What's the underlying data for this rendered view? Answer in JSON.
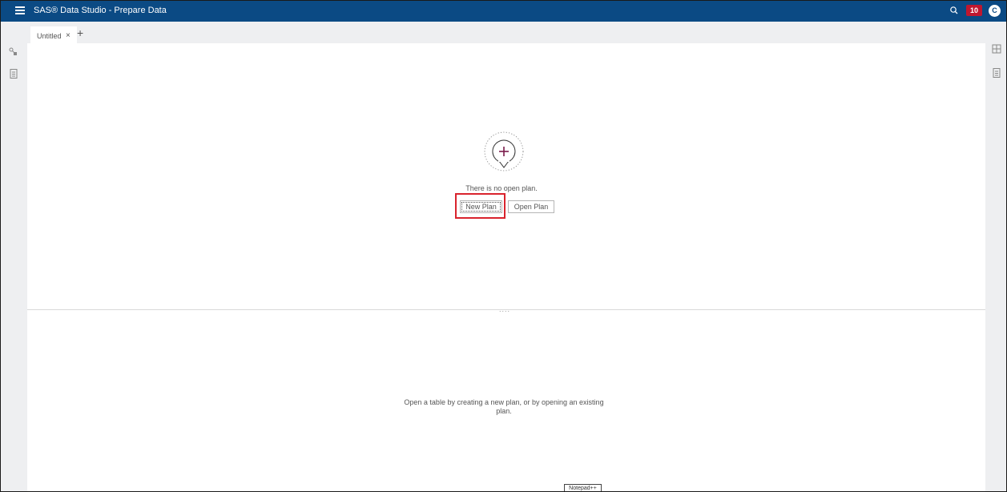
{
  "header": {
    "title": "SAS® Data Studio - Prepare Data",
    "notification_count": "10",
    "avatar_initial": "C",
    "menu_icon": "hamburger-menu-icon",
    "search_icon": "search-icon"
  },
  "tabs": [
    {
      "label": "Untitled",
      "close": "×"
    }
  ],
  "tab_add": "+",
  "left_rail": {
    "icons": [
      "data-source-icon",
      "document-icon"
    ]
  },
  "right_rail": {
    "icons": [
      "grid-icon",
      "document-icon"
    ]
  },
  "plan_area": {
    "message": "There is no open plan.",
    "new_plan": "New Plan",
    "open_plan": "Open Plan",
    "icon": "add-plan-icon"
  },
  "splitter": {
    "handle": "...."
  },
  "table_area": {
    "message": "Open a table by creating a new plan, or by opening an existing plan."
  },
  "taskbar": {
    "notepad": "Notepad++"
  },
  "colors": {
    "header_bg": "#0b4a84",
    "badge": "#c0172f",
    "highlight": "#d9232d",
    "plus": "#7a1a4a",
    "rail_bg": "#eeeff1"
  }
}
